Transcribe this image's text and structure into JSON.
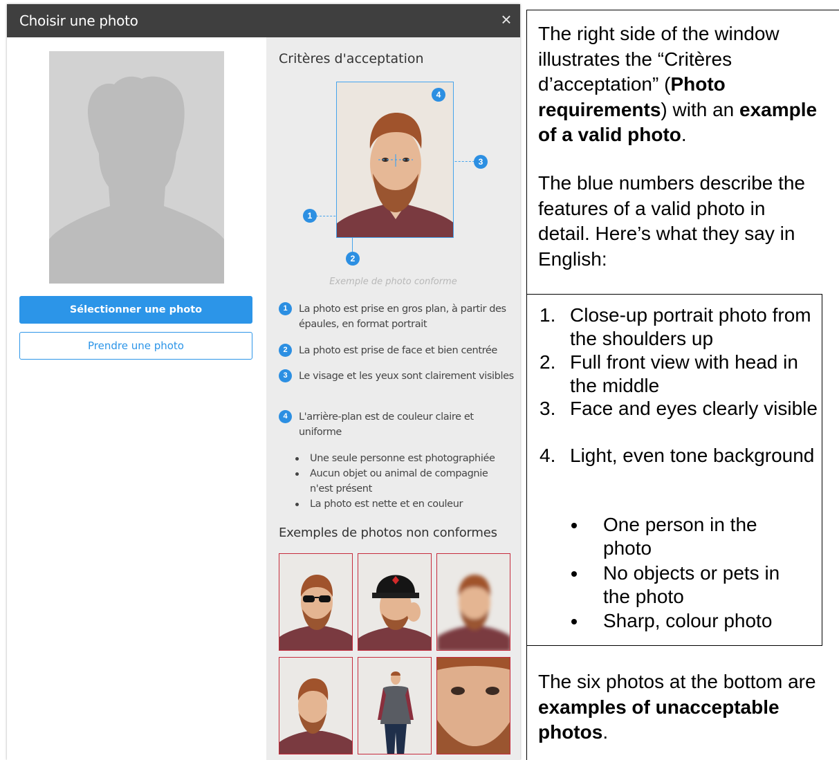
{
  "dialog": {
    "title": "Choisir une photo",
    "close_glyph": "×",
    "select_button_label": "Sélectionner une photo",
    "take_button_label": "Prendre une photo"
  },
  "criteria": {
    "heading": "Critères d'acceptation",
    "markers": [
      "1",
      "2",
      "3",
      "4"
    ],
    "example_caption": "Exemple de photo conforme",
    "items": [
      {
        "num": "1",
        "text": "La photo est prise en gros plan, à partir des épaules, en format portrait"
      },
      {
        "num": "2",
        "text": "La photo est prise de face et bien centrée"
      },
      {
        "num": "3",
        "text": "Le visage et les yeux sont clairement visibles"
      },
      {
        "num": "4",
        "text": "L'arrière-plan est de couleur claire et uniforme"
      }
    ],
    "bullets": [
      "Une seule personne est photographiée",
      "Aucun objet ou animal de compagnie n'est présent",
      "La photo est nette et en couleur"
    ],
    "bad_heading": "Exemples de photos non conformes"
  },
  "annotation": {
    "intro_1": "The right side of the window illustrates the “Critères d’acceptation” (",
    "intro_bold_1": "Photo requirements",
    "intro_2": ") with an ",
    "intro_bold_2": "example of a valid photo",
    "intro_3": ".",
    "numbers_text": "The blue numbers describe the features of a valid photo in detail. Here’s what they say in English:",
    "list": [
      {
        "num": "1.",
        "text": "Close-up portrait photo from the shoulders up"
      },
      {
        "num": "2.",
        "text": "Full front view with head in the middle"
      },
      {
        "num": "3.",
        "text": "Face and eyes clearly visible"
      },
      {
        "num": "4.",
        "text": "Light, even tone background"
      }
    ],
    "bullets": [
      "One person in the photo",
      "No objects or pets in the photo",
      "Sharp, colour photo"
    ],
    "six_1": "The six photos at the bottom are ",
    "six_bold": "examples of unacceptable photos",
    "six_2": "."
  },
  "colors": {
    "titlebar": "#3f3f3f",
    "accent_blue": "#2c95e8",
    "marker_blue": "#2c8fe2",
    "reject_red": "#c62b3c",
    "placeholder_gray": "#d2d2d2",
    "panel_gray": "#ececec"
  }
}
